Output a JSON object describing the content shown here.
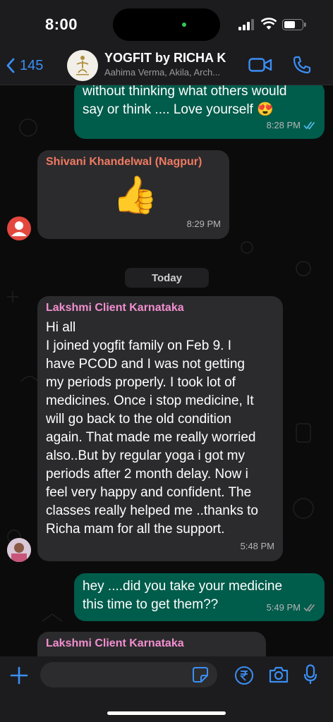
{
  "status": {
    "time": "8:00"
  },
  "header": {
    "back_count": "145",
    "title": "YOGFIT by RICHA K",
    "subtitle": "Aahima Verma, Akila, Arch..."
  },
  "messages": [
    {
      "id": "m1",
      "direction": "out",
      "text": "without thinking what others would\nsay or think .... Love yourself 😍",
      "time": "8:28 PM",
      "ticks": "read"
    },
    {
      "id": "m2",
      "direction": "in",
      "sender": "Shivani Khandelwal (Nagpur)",
      "sender_color": "#f07a62",
      "text": "👍",
      "time": "8:29 PM"
    },
    {
      "id": "m3",
      "direction": "in",
      "sender": "Lakshmi Client Karnataka",
      "sender_color": "#f28fd0",
      "text": "Hi all\nI joined yogfit family on Feb 9. I\nhave PCOD and I was not getting\nmy periods properly. I took lot of\nmedicines. Once i stop medicine, It\nwill go back to the old condition\nagain. That made me really worried\nalso..But by regular yoga i got my\nperiods after 2 month delay. Now i\nfeel very happy and confident. The\nclasses really helped me ..thanks to\nRicha mam for all the support.",
      "time": "5:48 PM"
    },
    {
      "id": "m4",
      "direction": "out",
      "text": "hey ....did you take your medicine\nthis time to get them??",
      "time": "5:49 PM",
      "ticks": "sent"
    },
    {
      "id": "m5",
      "direction": "in",
      "sender": "Lakshmi Client Karnataka",
      "sender_color": "#f28fd0",
      "text": "",
      "time": ""
    }
  ],
  "day_separator": "Today",
  "composer": {
    "placeholder": ""
  },
  "colors": {
    "accent": "#3b8ef5",
    "outgoing": "#005c4b",
    "incoming": "#2b2b2d",
    "read_tick": "#53bdeb"
  }
}
